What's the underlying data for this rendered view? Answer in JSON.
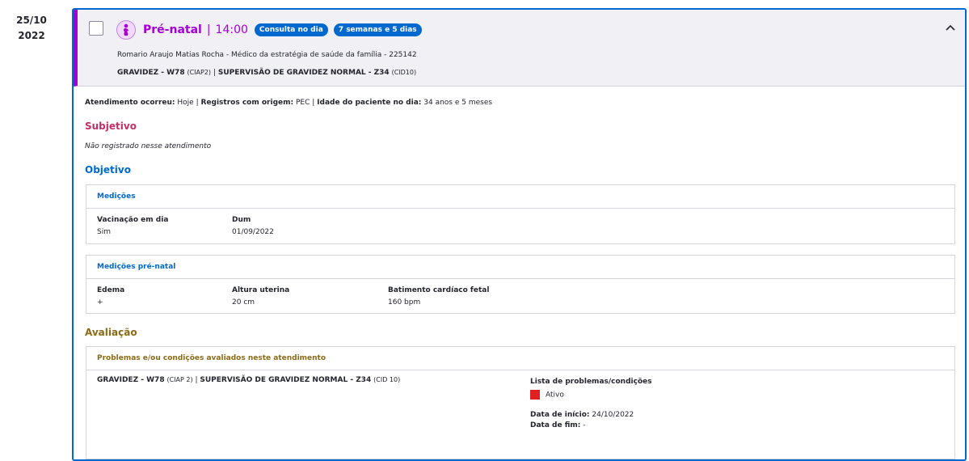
{
  "date": {
    "day": "25/10",
    "year": "2022"
  },
  "header": {
    "title": "Pré-natal",
    "separator": "|",
    "time": "14:00",
    "badge1": "Consulta no dia",
    "badge2": "7 semanas e 5 dias",
    "professional": "Romario Araujo Matias Rocha - Médico da estratégia de saúde da família - 225142",
    "diag_a": "GRAVIDEZ - W78",
    "diag_a_code": "(CIAP2)",
    "diag_sep": "|",
    "diag_b": "SUPERVISÃO DE GRAVIDEZ NORMAL - Z34",
    "diag_b_code": "(CID10)"
  },
  "meta": {
    "l1": "Atendimento ocorreu:",
    "v1": "Hoje",
    "sep": "|",
    "l2": "Registros com origem:",
    "v2": "PEC",
    "l3": "Idade do paciente no dia:",
    "v3": "34 anos e 5 meses"
  },
  "subjetivo": {
    "title": "Subjetivo",
    "note": "Não registrado nesse atendimento"
  },
  "objetivo": {
    "title": "Objetivo",
    "medicoes": {
      "title": "Medições",
      "f1_label": "Vacinação em dia",
      "f1_value": "Sim",
      "f2_label": "Dum",
      "f2_value": "01/09/2022"
    },
    "prenatal": {
      "title": "Medições pré-natal",
      "f1_label": "Edema",
      "f1_value": "+",
      "f2_label": "Altura uterina",
      "f2_value": "20 cm",
      "f3_label": "Batimento cardíaco fetal",
      "f3_value": "160 bpm"
    }
  },
  "avaliacao": {
    "title": "Avaliação",
    "box_title": "Problemas e/ou condições avaliados neste atendimento",
    "diag_a": "GRAVIDEZ - W78",
    "diag_a_code": "(CIAP 2)",
    "diag_sep": "|",
    "diag_b": "SUPERVISÃO DE GRAVIDEZ NORMAL - Z34",
    "diag_b_code": "(CID 10)",
    "list_label": "Lista de problemas/condições",
    "status": "Ativo",
    "status_color": "#e02020",
    "start_label": "Data de início:",
    "start_value": "24/10/2022",
    "end_label": "Data de fim:",
    "end_value": "-"
  },
  "colors": {
    "accent": "#0069d0",
    "prenatal": "#a700d4",
    "subjetivo": "#c22e6b",
    "avaliacao": "#8c6b18"
  }
}
